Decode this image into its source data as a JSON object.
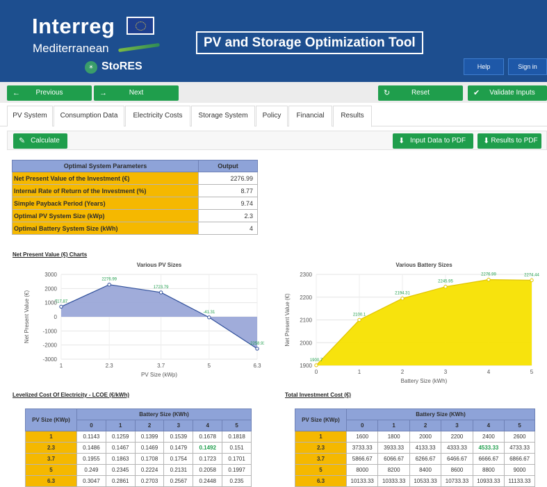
{
  "header": {
    "logo_word": "Interreg",
    "logo_sub": "Mediterranean",
    "project": "StoRES",
    "app_title": "PV and Storage Optimization Tool",
    "help_label": "Help",
    "signin_label": "Sign in",
    "brand_color": "#1d4e8f"
  },
  "actions": {
    "previous": "Previous",
    "next": "Next",
    "reset": "Reset",
    "validate": "Validate Inputs",
    "accent": "#1f9e4c"
  },
  "tabs": [
    "PV System",
    "Consumption Data",
    "Electricity Costs",
    "Storage System",
    "Policy",
    "Financial",
    "Results"
  ],
  "active_tab": "Results",
  "toolbar": {
    "calculate": "Calculate",
    "input_pdf": "Input Data to PDF",
    "results_pdf": "Results to PDF"
  },
  "optimal": {
    "headers": [
      "Optimal System Parameters",
      "Output"
    ],
    "rows": [
      {
        "label": "Net Present Value of the Investment (€)",
        "value": "2276.99"
      },
      {
        "label": "Internal Rate of Return of the Investment (%)",
        "value": "8.77"
      },
      {
        "label": "Simple Payback Period (Years)",
        "value": "9.74"
      },
      {
        "label": "Optimal PV System Size (kWp)",
        "value": "2.3"
      },
      {
        "label": "Optimal Battery System Size (kWh)",
        "value": "4"
      }
    ]
  },
  "npv_section_title": "Net Present Value (€) Charts",
  "chart_data": [
    {
      "type": "area",
      "title": "Various PV Sizes",
      "xlabel": "PV Size (kWp)",
      "ylabel": "Net Present Value (€)",
      "x": [
        1,
        2.3,
        3.7,
        5,
        6.3
      ],
      "x_tick_labels": [
        "1",
        "2.3",
        "3.7",
        "5",
        "6.3"
      ],
      "values": [
        717.87,
        2276.99,
        1723.79,
        -41.31,
        -2258.93
      ],
      "point_labels": [
        "717.87",
        "2276.99",
        "1723.79",
        "-41.31",
        "-2258.93"
      ],
      "ylim": [
        -3000,
        3000
      ],
      "y_ticks": [
        3000,
        2000,
        1000,
        0,
        -1000,
        -2000,
        -3000
      ],
      "fill_color": "#9ba8d8",
      "line_color": "#2f4f9a"
    },
    {
      "type": "area",
      "title": "Various Battery Sizes",
      "xlabel": "Battery Size (kWh)",
      "ylabel": "Net Present Value (€)",
      "x": [
        0,
        1,
        2,
        3,
        4,
        5
      ],
      "x_tick_labels": [
        "0",
        "1",
        "2",
        "3",
        "4",
        "5"
      ],
      "values": [
        1900.7,
        2100.1,
        2194.31,
        2245.95,
        2276.99,
        2274.44
      ],
      "point_labels": [
        "1900.7",
        "2100.1",
        "2194.31",
        "2245.95",
        "2276.99",
        "2274.44"
      ],
      "ylim": [
        1900,
        2300
      ],
      "y_ticks": [
        2300,
        2200,
        2100,
        2000,
        1900
      ],
      "fill_color": "#f7e100",
      "line_color": "#e0c400"
    }
  ],
  "lcoe": {
    "title": "Levelized Cost Of Electricity - LCOE (€/kWh)",
    "row_header": "PV Size (KWp)",
    "col_header": "Battery Size (KWh)",
    "cols": [
      "0",
      "1",
      "2",
      "3",
      "4",
      "5"
    ],
    "rows": [
      {
        "pv": "1",
        "vals": [
          "0.1143",
          "0.1259",
          "0.1399",
          "0.1539",
          "0.1678",
          "0.1818"
        ]
      },
      {
        "pv": "2.3",
        "vals": [
          "0.1486",
          "0.1467",
          "0.1469",
          "0.1479",
          "0.1492",
          "0.151"
        ]
      },
      {
        "pv": "3.7",
        "vals": [
          "0.1955",
          "0.1863",
          "0.1708",
          "0.1754",
          "0.1723",
          "0.1701"
        ]
      },
      {
        "pv": "5",
        "vals": [
          "0.249",
          "0.2345",
          "0.2224",
          "0.2131",
          "0.2058",
          "0.1997"
        ]
      },
      {
        "pv": "6.3",
        "vals": [
          "0.3047",
          "0.2861",
          "0.2703",
          "0.2567",
          "0.2448",
          "0.235"
        ]
      }
    ],
    "highlight": {
      "row": 1,
      "col": 4
    }
  },
  "invest": {
    "title": "Total Investment Cost (€)",
    "row_header": "PV Size (KWp)",
    "col_header": "Battery Size (KWh)",
    "cols": [
      "0",
      "1",
      "2",
      "3",
      "4",
      "5"
    ],
    "rows": [
      {
        "pv": "1",
        "vals": [
          "1600",
          "1800",
          "2000",
          "2200",
          "2400",
          "2600"
        ]
      },
      {
        "pv": "2.3",
        "vals": [
          "3733.33",
          "3933.33",
          "4133.33",
          "4333.33",
          "4533.33",
          "4733.33"
        ]
      },
      {
        "pv": "3.7",
        "vals": [
          "5866.67",
          "6066.67",
          "6266.67",
          "6466.67",
          "6666.67",
          "6866.67"
        ]
      },
      {
        "pv": "5",
        "vals": [
          "8000",
          "8200",
          "8400",
          "8600",
          "8800",
          "9000"
        ]
      },
      {
        "pv": "6.3",
        "vals": [
          "10133.33",
          "10333.33",
          "10533.33",
          "10733.33",
          "10933.33",
          "11133.33"
        ]
      }
    ],
    "highlight": {
      "row": 1,
      "col": 4
    }
  }
}
